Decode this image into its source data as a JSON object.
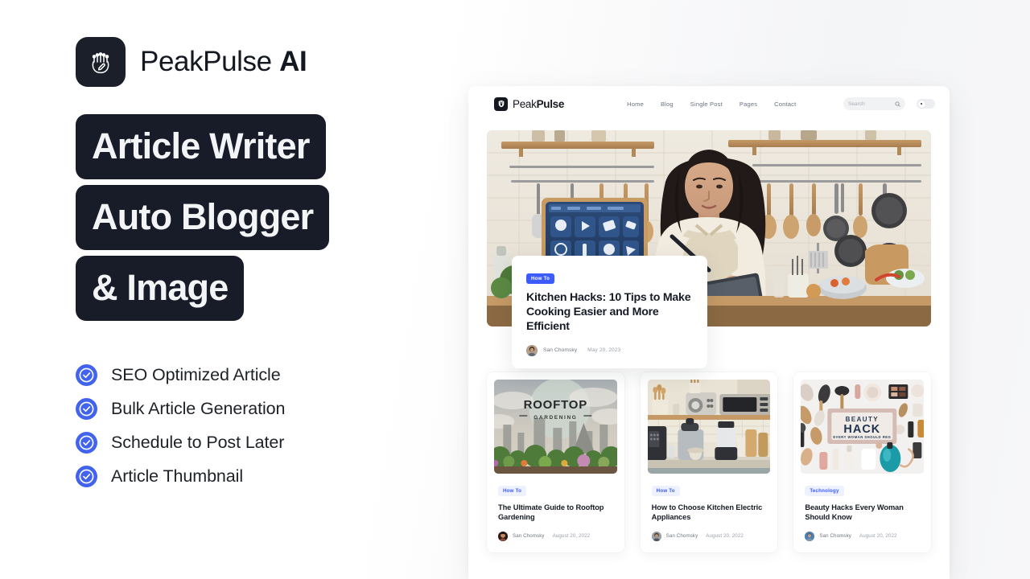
{
  "brand": {
    "name_regular": "PeakPulse",
    "name_bold": "AI",
    "logo_icon": "hand-circuit-icon"
  },
  "headline": {
    "lines": [
      "Article Writer",
      "Auto Blogger",
      "& Image"
    ]
  },
  "features": [
    {
      "label": "SEO Optimized Article",
      "icon": "check-circle-icon"
    },
    {
      "label": "Bulk Article Generation",
      "icon": "check-circle-icon"
    },
    {
      "label": "Schedule to Post Later",
      "icon": "check-circle-icon"
    },
    {
      "label": "Article Thumbnail",
      "icon": "check-circle-icon"
    }
  ],
  "colors": {
    "accent_blue": "#3b5bfd",
    "check_blue": "#4263eb",
    "headline_bg": "#181c29",
    "text_dark": "#161b26",
    "text_muted": "#6b7280"
  },
  "site": {
    "brand_regular": "Peak",
    "brand_bold": "Pulse",
    "logo_icon": "shield-crest-icon",
    "nav": [
      {
        "label": "Home"
      },
      {
        "label": "Blog"
      },
      {
        "label": "Single Post"
      },
      {
        "label": "Pages"
      },
      {
        "label": "Contact"
      }
    ],
    "search": {
      "placeholder": "Search",
      "icon": "search-icon"
    },
    "theme_toggle": {
      "state": "off",
      "icon": "theme-toggle-icon"
    },
    "hero": {
      "image_alt": "woman-cooking-in-kitchen-with-tablet",
      "badge": "How To",
      "title": "Kitchen Hacks: 10 Tips to Make Cooking Easier and More Efficient",
      "author": "San Chomsky",
      "date": "May 20, 2023"
    },
    "posts": [
      {
        "image_alt": "rooftop-gardening-city-skyline",
        "image_text_primary": "ROOFTOP",
        "image_text_secondary": "GARDENING",
        "badge": "How To",
        "title": "The Ultimate Guide to Rooftop Gardening",
        "author": "San Chomsky",
        "date": "August 20, 2022"
      },
      {
        "image_alt": "kitchen-electric-appliances-on-counter",
        "badge": "How To",
        "title": "How to Choose Kitchen Electric Appliances",
        "author": "San Chomsky",
        "date": "August 20, 2022"
      },
      {
        "image_alt": "beauty-hack-products-flatlay",
        "image_text_primary": "BEAUTY",
        "image_text_secondary": "HACK",
        "image_text_tertiary": "EVERY WOMAN SHOULD REG",
        "badge": "Technology",
        "title": "Beauty Hacks Every Woman Should Know",
        "author": "San Chomsky",
        "date": "August 20, 2022"
      }
    ]
  }
}
